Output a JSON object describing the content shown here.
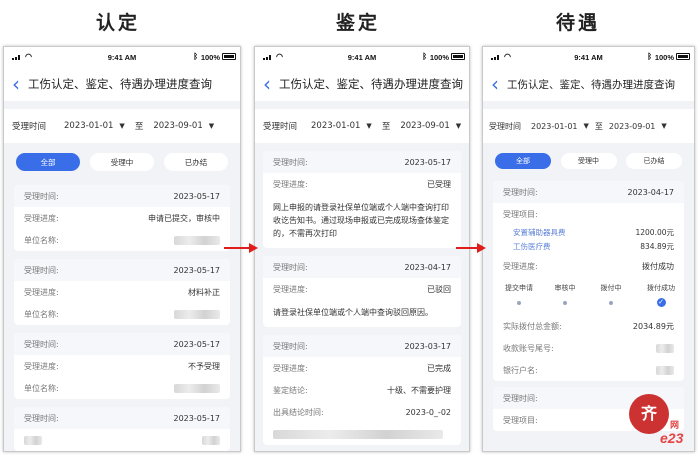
{
  "headings": [
    "认定",
    "鉴定",
    "待遇"
  ],
  "status_bar": {
    "time": "9:41 AM",
    "battery": "100%"
  },
  "page_title": "工伤认定、鉴定、待遇办理进度查询",
  "date_filter": {
    "label": "受理时间",
    "from": "2023-01-01",
    "to_label": "至",
    "to": "2023-09-01"
  },
  "tabs": [
    "全部",
    "受理中",
    "已办结"
  ],
  "screen1": {
    "records": [
      {
        "rows": [
          {
            "k": "受理时间:",
            "v": "2023-05-17"
          },
          {
            "k": "受理进度:",
            "v": "申请已提交，审核中"
          },
          {
            "k": "单位名称:",
            "v": ""
          }
        ]
      },
      {
        "rows": [
          {
            "k": "受理时间:",
            "v": "2023-05-17"
          },
          {
            "k": "受理进度:",
            "v": "材料补正"
          },
          {
            "k": "单位名称:",
            "v": ""
          }
        ]
      },
      {
        "rows": [
          {
            "k": "受理时间:",
            "v": "2023-05-17"
          },
          {
            "k": "受理进度:",
            "v": "不予受理"
          },
          {
            "k": "单位名称:",
            "v": ""
          }
        ]
      },
      {
        "rows": [
          {
            "k": "受理时间:",
            "v": "2023-05-17"
          },
          {
            "k": "",
            "v": ""
          }
        ]
      }
    ]
  },
  "screen2": {
    "record1": {
      "time_k": "受理时间:",
      "time_v": "2023-05-17",
      "prog_k": "受理进度:",
      "prog_v": "已受理",
      "note": "网上申报的请登录社保单位端或个人端中查询打印收讫告知书。通过现场申报或已完成现场查体鉴定的，不需再次打印"
    },
    "record2": {
      "time_k": "受理时间:",
      "time_v": "2023-04-17",
      "prog_k": "受理进度:",
      "prog_v": "已驳回",
      "note": "请登录社保单位端或个人端中查询驳回原因。"
    },
    "record3": {
      "time_k": "受理时间:",
      "time_v": "2023-03-17",
      "prog_k": "受理进度:",
      "prog_v": "已完成",
      "concl_k": "鉴定结论:",
      "concl_v": "十级、不需要护理",
      "date_k": "出具结论时间:",
      "date_v": "2023-0_-02"
    }
  },
  "screen3": {
    "record1": {
      "time_k": "受理时间:",
      "time_v": "2023-04-17",
      "items_k": "受理项目:",
      "items": [
        {
          "name": "安置辅助器具费",
          "amount": "1200.00元"
        },
        {
          "name": "工伤医疗费",
          "amount": "834.89元"
        }
      ],
      "prog_k": "受理进度:",
      "prog_v": "拨付成功",
      "steps": [
        "提交申请",
        "审核中",
        "拨付中",
        "拨付成功"
      ],
      "total_k": "实际拨付总金额:",
      "total_v": "2034.89元",
      "account_k": "收款账号尾号:",
      "holder_k": "银行户名:"
    },
    "record2": {
      "time_k": "受理时间:",
      "items_k": "受理项目:"
    }
  },
  "watermark": {
    "logo": "齐",
    "text": "e23",
    "small": "网"
  }
}
